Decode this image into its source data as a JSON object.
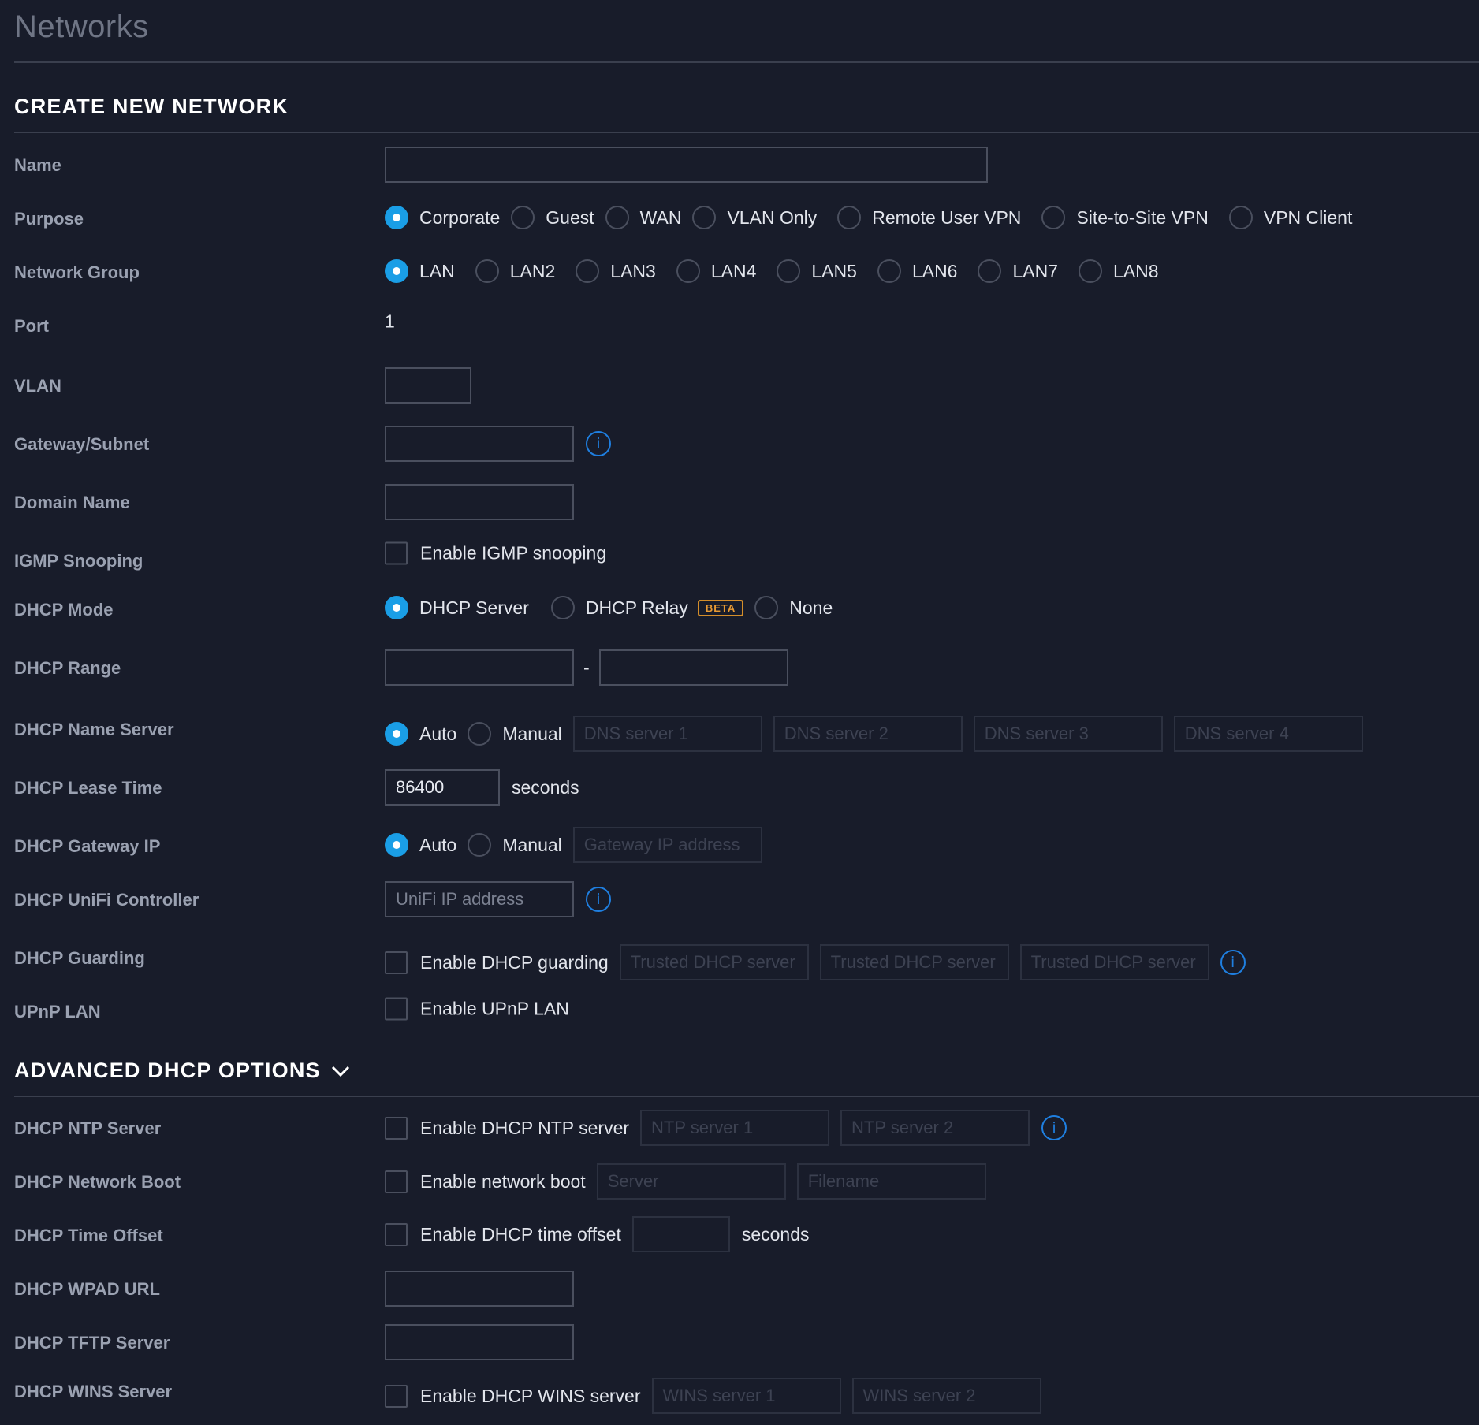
{
  "page_title": "Networks",
  "section_create": "CREATE NEW NETWORK",
  "section_advanced": "ADVANCED DHCP OPTIONS",
  "accent_color": "#1a9ee6",
  "info_color": "#1f7fe0",
  "beta_color": "#e89a33",
  "fields": {
    "name": {
      "label": "Name",
      "value": ""
    },
    "purpose": {
      "label": "Purpose",
      "selected": "Corporate",
      "options": [
        "Corporate",
        "Guest",
        "WAN",
        "VLAN Only",
        "Remote User VPN",
        "Site-to-Site VPN",
        "VPN Client"
      ]
    },
    "network_group": {
      "label": "Network Group",
      "selected": "LAN",
      "options": [
        "LAN",
        "LAN2",
        "LAN3",
        "LAN4",
        "LAN5",
        "LAN6",
        "LAN7",
        "LAN8"
      ]
    },
    "port": {
      "label": "Port",
      "value": "1"
    },
    "vlan": {
      "label": "VLAN",
      "value": ""
    },
    "gateway_subnet": {
      "label": "Gateway/Subnet",
      "value": "",
      "icon": "info-icon"
    },
    "domain_name": {
      "label": "Domain Name",
      "value": ""
    },
    "igmp": {
      "label": "IGMP Snooping",
      "checkbox_label": "Enable IGMP snooping",
      "checked": false
    },
    "dhcp_mode": {
      "label": "DHCP Mode",
      "selected": "DHCP Server",
      "options": [
        "DHCP Server",
        "DHCP Relay",
        "None"
      ],
      "beta_badge": "BETA"
    },
    "dhcp_range": {
      "label": "DHCP Range",
      "start": "",
      "separator": "-",
      "end": ""
    },
    "dhcp_name_server": {
      "label": "DHCP Name Server",
      "selected": "Auto",
      "options": [
        "Auto",
        "Manual"
      ],
      "placeholders": [
        "DNS server 1",
        "DNS server 2",
        "DNS server 3",
        "DNS server 4"
      ]
    },
    "dhcp_lease_time": {
      "label": "DHCP Lease Time",
      "value": "86400",
      "unit": "seconds"
    },
    "dhcp_gateway_ip": {
      "label": "DHCP Gateway IP",
      "selected": "Auto",
      "options": [
        "Auto",
        "Manual"
      ],
      "placeholder": "Gateway IP address"
    },
    "dhcp_unifi_controller": {
      "label": "DHCP UniFi Controller",
      "placeholder": "UniFi IP address",
      "icon": "info-icon"
    },
    "dhcp_guarding": {
      "label": "DHCP Guarding",
      "checkbox_label": "Enable DHCP guarding",
      "checked": false,
      "placeholders": [
        "Trusted DHCP server",
        "Trusted DHCP server",
        "Trusted DHCP server"
      ],
      "icon": "info-icon"
    },
    "upnp_lan": {
      "label": "UPnP LAN",
      "checkbox_label": "Enable UPnP LAN",
      "checked": false
    }
  },
  "advanced": {
    "ntp": {
      "label": "DHCP NTP Server",
      "checkbox_label": "Enable DHCP NTP server",
      "checked": false,
      "placeholders": [
        "NTP server 1",
        "NTP server 2"
      ],
      "icon": "info-icon"
    },
    "network_boot": {
      "label": "DHCP Network Boot",
      "checkbox_label": "Enable network boot",
      "checked": false,
      "placeholders": [
        "Server",
        "Filename"
      ]
    },
    "time_offset": {
      "label": "DHCP Time Offset",
      "checkbox_label": "Enable DHCP time offset",
      "checked": false,
      "value": "",
      "unit": "seconds"
    },
    "wpad_url": {
      "label": "DHCP WPAD URL",
      "value": ""
    },
    "tftp_server": {
      "label": "DHCP TFTP Server",
      "value": ""
    },
    "wins_server": {
      "label": "DHCP WINS Server",
      "checkbox_label": "Enable DHCP WINS server",
      "checked": false,
      "placeholders": [
        "WINS server 1",
        "WINS server 2"
      ]
    }
  }
}
